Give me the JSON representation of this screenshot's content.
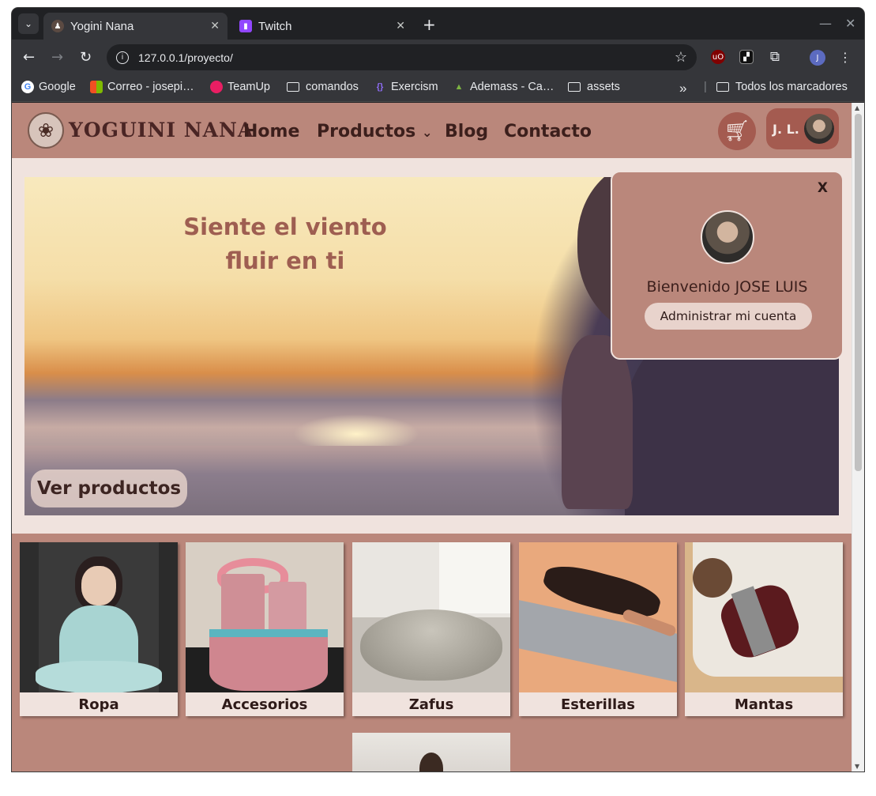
{
  "browser": {
    "tabs": [
      {
        "title": "Yogini Nana",
        "active": true
      },
      {
        "title": "Twitch",
        "active": false
      }
    ],
    "address": "127.0.0.1/proyecto/",
    "profile_initial": "J",
    "bookmarks": [
      {
        "label": "Google",
        "icon": "google-icon"
      },
      {
        "label": "Correo - josepi…",
        "icon": "outlook-icon"
      },
      {
        "label": "TeamUp",
        "icon": "teamup-icon"
      },
      {
        "label": "comandos",
        "icon": "folder-icon"
      },
      {
        "label": "Exercism",
        "icon": "exercism-icon"
      },
      {
        "label": "Ademass - Ca…",
        "icon": "ademass-icon"
      },
      {
        "label": "assets",
        "icon": "folder-icon"
      }
    ],
    "all_bookmarks": "Todos los marcadores"
  },
  "site": {
    "brand": "YOGUINI NANA",
    "menu": [
      {
        "label": "Home"
      },
      {
        "label": "Productos",
        "has_dropdown": true
      },
      {
        "label": "Blog"
      },
      {
        "label": "Contacto"
      }
    ],
    "user_initials": "J. L.",
    "hero": {
      "slogan_line1": "Siente el viento",
      "slogan_line2": "fluir en ti",
      "cta": "Ver productos"
    },
    "popup": {
      "close": "X",
      "welcome": "Bienvenido JOSE LUIS",
      "account_button": "Administrar mi cuenta"
    },
    "categories": [
      {
        "label": "Ropa"
      },
      {
        "label": "Accesorios"
      },
      {
        "label": "Zafus"
      },
      {
        "label": "Esterillas"
      },
      {
        "label": "Mantas"
      }
    ],
    "colors": {
      "nav": "#ba877b",
      "accent": "#a45b50",
      "background": "#f0e3de",
      "slogan": "#9e5e51"
    }
  }
}
